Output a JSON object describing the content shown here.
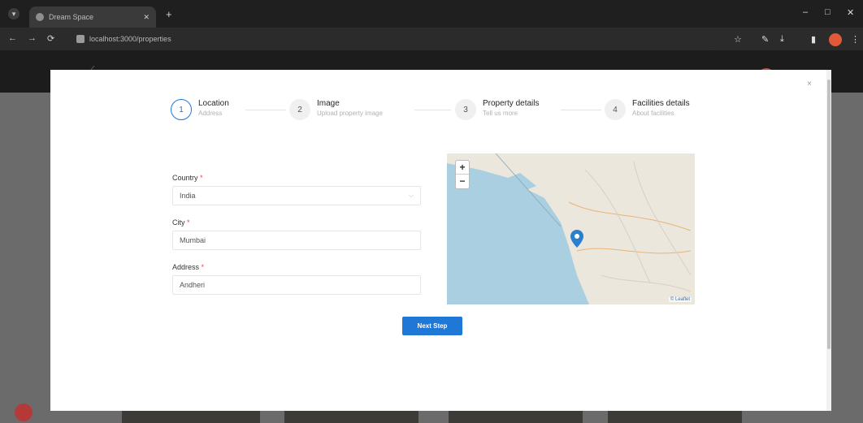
{
  "browser": {
    "tab_title": "Dream Space",
    "url": "localhost:3000/properties",
    "new_tab_glyph": "+",
    "tab_close_glyph": "✕"
  },
  "modal": {
    "close_glyph": "×"
  },
  "steps": [
    {
      "number": "1",
      "title": "Location",
      "subtitle": "Address"
    },
    {
      "number": "2",
      "title": "Image",
      "subtitle": "Upload property image"
    },
    {
      "number": "3",
      "title": "Property details",
      "subtitle": "Tell us more"
    },
    {
      "number": "4",
      "title": "Facilities details",
      "subtitle": "About facilities"
    }
  ],
  "form": {
    "country": {
      "label": "Country",
      "value": "India"
    },
    "city": {
      "label": "City",
      "value": "Mumbai"
    },
    "address": {
      "label": "Address",
      "value": "Andheri"
    },
    "required_mark": "*"
  },
  "map": {
    "zoom_in": "+",
    "zoom_out": "−",
    "attribution": "© Leaflet",
    "sea_color": "#a9cfe0",
    "land_color": "#ebe7dc",
    "marker_color": "#2a7fcf"
  },
  "buttons": {
    "next_step": "Next Step"
  },
  "icons": {
    "step_active_color": "#1f77d6",
    "primary_color": "#1f77d6"
  }
}
